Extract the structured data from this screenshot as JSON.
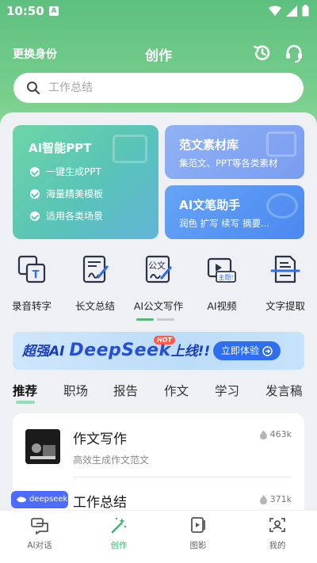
{
  "status": {
    "time": "10:50",
    "notif_letter": "A"
  },
  "header": {
    "switch_identity": "更换身份",
    "title": "创作"
  },
  "search": {
    "placeholder": "工作总结"
  },
  "cards": {
    "ppt": {
      "title": "AI智能PPT",
      "features": [
        "一键生成PPT",
        "海量精美模板",
        "适用各类场景"
      ]
    },
    "library": {
      "title": "范文素材库",
      "subtitle": "集范文、PPT等各类素材"
    },
    "pen": {
      "title": "AI文笔助手",
      "subtitle": "润色 扩写 续写 摘要..."
    }
  },
  "tools": [
    {
      "label": "录音转字",
      "icon": "audio-to-text-icon",
      "glyph": "T"
    },
    {
      "label": "长文总结",
      "icon": "long-text-summary-icon"
    },
    {
      "label": "AI公文写作",
      "icon": "official-doc-icon",
      "glyph": "公文"
    },
    {
      "label": "AI视频",
      "icon": "ai-video-icon",
      "glyph": "主题!"
    },
    {
      "label": "文字提取",
      "icon": "text-extract-icon"
    }
  ],
  "pager": {
    "count": 2,
    "active": 0
  },
  "banner": {
    "prefix": "超强AI",
    "brand": "DeepSeek",
    "suffix": "上线!!",
    "hot": "HOT",
    "button": "立即体验"
  },
  "categories": [
    "推荐",
    "职场",
    "报告",
    "作文",
    "学习",
    "发言稿"
  ],
  "active_category": 0,
  "list": [
    {
      "title": "作文写作",
      "subtitle": "高效生成作文范文",
      "count": "463k"
    },
    {
      "title": "工作总结",
      "subtitle": "",
      "count": "371k"
    }
  ],
  "floating_badge": "deepseek",
  "tabbar": [
    {
      "label": "AI对话",
      "icon": "chat-icon"
    },
    {
      "label": "创作",
      "icon": "magic-wand-icon"
    },
    {
      "label": "图影",
      "icon": "video-frame-icon"
    },
    {
      "label": "我的",
      "icon": "profile-icon"
    }
  ],
  "active_tab": 1,
  "colors": {
    "accent": "#3fb36b",
    "header_green": "#5ec07f",
    "banner_blue": "#2f6ef0"
  }
}
